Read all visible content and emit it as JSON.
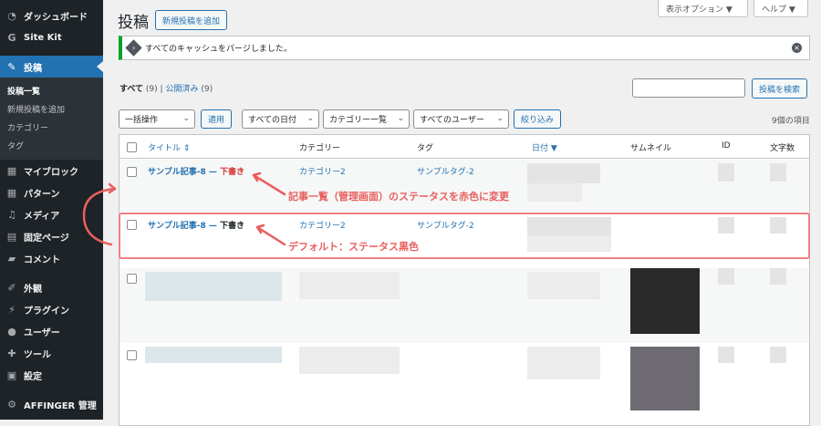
{
  "sidebar": {
    "items": [
      {
        "icon": "dashboard-icon",
        "label": "ダッシュボード"
      },
      {
        "icon": "sitekit-icon",
        "label": "Site Kit"
      },
      {
        "icon": "pin-icon",
        "label": "投稿"
      },
      {
        "icon": "blocks-icon",
        "label": "マイブロック"
      },
      {
        "icon": "pattern-icon",
        "label": "パターン"
      },
      {
        "icon": "media-icon",
        "label": "メディア"
      },
      {
        "icon": "page-icon",
        "label": "固定ページ"
      },
      {
        "icon": "comment-icon",
        "label": "コメント"
      },
      {
        "icon": "appearance-icon",
        "label": "外観"
      },
      {
        "icon": "plugin-icon",
        "label": "プラグイン"
      },
      {
        "icon": "user-icon",
        "label": "ユーザー"
      },
      {
        "icon": "tool-icon",
        "label": "ツール"
      },
      {
        "icon": "settings-icon",
        "label": "設定"
      },
      {
        "icon": "gear-icon",
        "label": "AFFINGER 管理"
      }
    ],
    "submenu": [
      "投稿一覧",
      "新規投稿を追加",
      "カテゴリー",
      "タグ"
    ]
  },
  "header": {
    "title": "投稿",
    "add_new": "新規投稿を追加",
    "screen_options": "表示オプション ▼",
    "help": "ヘルプ ▼"
  },
  "notice": {
    "text": "すべてのキャッシュをパージしました。"
  },
  "views": {
    "all": "すべて",
    "all_count": "(9)",
    "sep": "|",
    "published": "公開済み",
    "published_count": "(9)"
  },
  "search": {
    "button": "投稿を検索",
    "value": ""
  },
  "filters": {
    "bulk": "一括操作",
    "apply": "適用",
    "dates": "すべての日付",
    "categories": "カテゴリー一覧",
    "users": "すべてのユーザー",
    "filter": "絞り込み",
    "items_count": "9個の項目"
  },
  "table": {
    "columns": {
      "title": "タイトル ⇕",
      "category": "カテゴリー",
      "tag": "タグ",
      "date": "日付 ▼",
      "thumbnail": "サムネイル",
      "id": "ID",
      "chars": "文字数"
    },
    "rows": [
      {
        "title": "サンプル記事-8 — ",
        "status": "下書き",
        "status_color": "#d63638",
        "category": "カテゴリー2",
        "tag": "サンプルタグ-2"
      },
      {
        "title": "サンプル記事-8 — ",
        "status": "下書き",
        "status_color": "#1d2327",
        "category": "カテゴリー2",
        "tag": "サンプルタグ-2"
      }
    ]
  },
  "annotations": {
    "red": "記事一覧（管理画面）のステータスを赤色に変更",
    "default": "デフォルト：ステータス黒色",
    "color": "#e8605f"
  }
}
